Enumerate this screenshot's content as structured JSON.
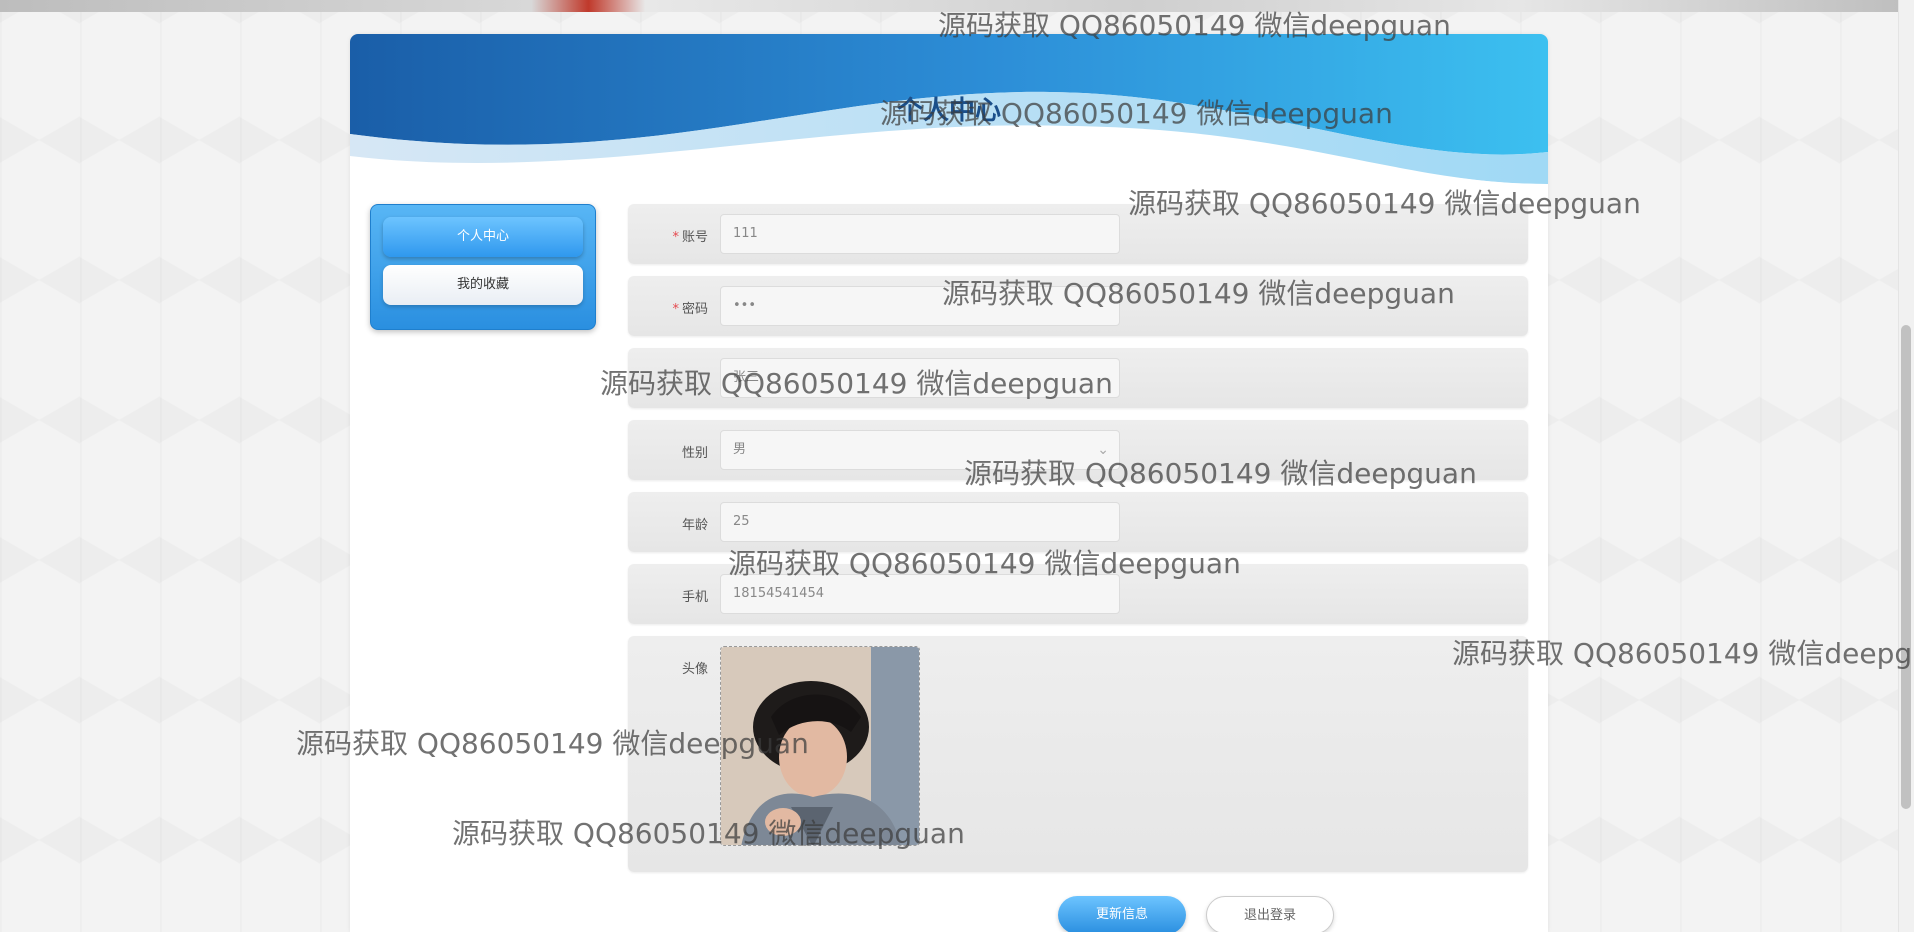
{
  "header": {
    "title": "个人中心"
  },
  "sidebar": {
    "items": [
      {
        "label": "个人中心",
        "active": true
      },
      {
        "label": "我的收藏",
        "active": false
      }
    ]
  },
  "form": {
    "account": {
      "label": "账号",
      "required": true,
      "value": "111"
    },
    "password": {
      "label": "密码",
      "required": true,
      "value": "•••"
    },
    "name": {
      "label": "",
      "value": "张三"
    },
    "gender": {
      "label": "性别",
      "value": "男"
    },
    "age": {
      "label": "年龄",
      "value": "25"
    },
    "phone": {
      "label": "手机",
      "value": "18154541454"
    },
    "avatar": {
      "label": "头像"
    }
  },
  "actions": {
    "update": "更新信息",
    "logout": "退出登录"
  },
  "watermark": {
    "text": "源码获取 QQ86050149 微信deepguan"
  },
  "colors": {
    "accent": "#2a8fe0",
    "required": "#e5484d",
    "title": "#1b4f8a"
  }
}
